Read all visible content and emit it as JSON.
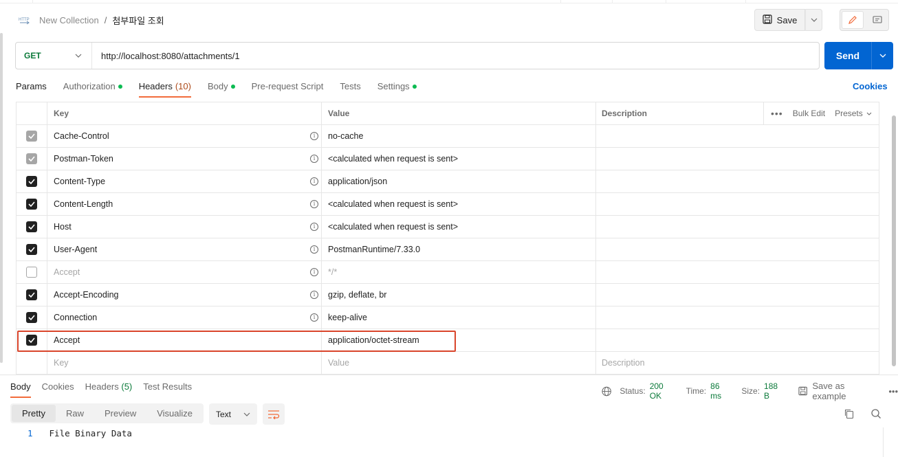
{
  "breadcrumb": {
    "collection": "New Collection",
    "separator": "/",
    "request_name": "첨부파일 조회",
    "icon": "http-icon"
  },
  "toolbar": {
    "save_label": "Save"
  },
  "request": {
    "method": "GET",
    "url": "http://localhost:8080/attachments/1",
    "send_label": "Send"
  },
  "request_tabs": [
    {
      "label": "Params",
      "dot": false
    },
    {
      "label": "Authorization",
      "dot": true
    },
    {
      "label": "Headers",
      "count": "(10)",
      "active": true
    },
    {
      "label": "Body",
      "dot": true
    },
    {
      "label": "Pre-request Script"
    },
    {
      "label": "Tests"
    },
    {
      "label": "Settings",
      "dot": true
    }
  ],
  "cookies_link": "Cookies",
  "headers_table": {
    "columns": {
      "key": "Key",
      "value": "Value",
      "description": "Description"
    },
    "bulk_edit": "Bulk Edit",
    "presets": "Presets",
    "rows": [
      {
        "key": "Cache-Control",
        "value": "no-cache",
        "state": "grey",
        "info": true
      },
      {
        "key": "Postman-Token",
        "value": "<calculated when request is sent>",
        "state": "grey",
        "info": true
      },
      {
        "key": "Content-Type",
        "value": "application/json",
        "state": "on",
        "info": true
      },
      {
        "key": "Content-Length",
        "value": "<calculated when request is sent>",
        "state": "on",
        "info": true
      },
      {
        "key": "Host",
        "value": "<calculated when request is sent>",
        "state": "on",
        "info": true
      },
      {
        "key": "User-Agent",
        "value": "PostmanRuntime/7.33.0",
        "state": "on",
        "info": true
      },
      {
        "key": "Accept",
        "value": "*/*",
        "state": "off",
        "info": true
      },
      {
        "key": "Accept-Encoding",
        "value": "gzip, deflate, br",
        "state": "on",
        "info": true
      },
      {
        "key": "Connection",
        "value": "keep-alive",
        "state": "on",
        "info": true
      },
      {
        "key": "Accept",
        "value": "application/octet-stream",
        "state": "on",
        "info": false
      }
    ],
    "placeholders": {
      "key": "Key",
      "value": "Value",
      "description": "Description"
    }
  },
  "response": {
    "tabs": [
      {
        "label": "Body",
        "active": true
      },
      {
        "label": "Cookies"
      },
      {
        "label": "Headers",
        "count": "(5)"
      },
      {
        "label": "Test Results"
      }
    ],
    "status_label": "Status:",
    "status_value": "200 OK",
    "time_label": "Time:",
    "time_value": "86 ms",
    "size_label": "Size:",
    "size_value": "188 B",
    "save_example": "Save as example",
    "view_modes": [
      "Pretty",
      "Raw",
      "Preview",
      "Visualize"
    ],
    "active_view": "Pretty",
    "format": "Text",
    "line_number": "1",
    "body_text": "File Binary Data"
  },
  "colors": {
    "accent_orange": "#f26b3a",
    "send_blue": "#0265d2",
    "method_green": "#0b7a3a",
    "highlight_red": "#d9442a"
  }
}
